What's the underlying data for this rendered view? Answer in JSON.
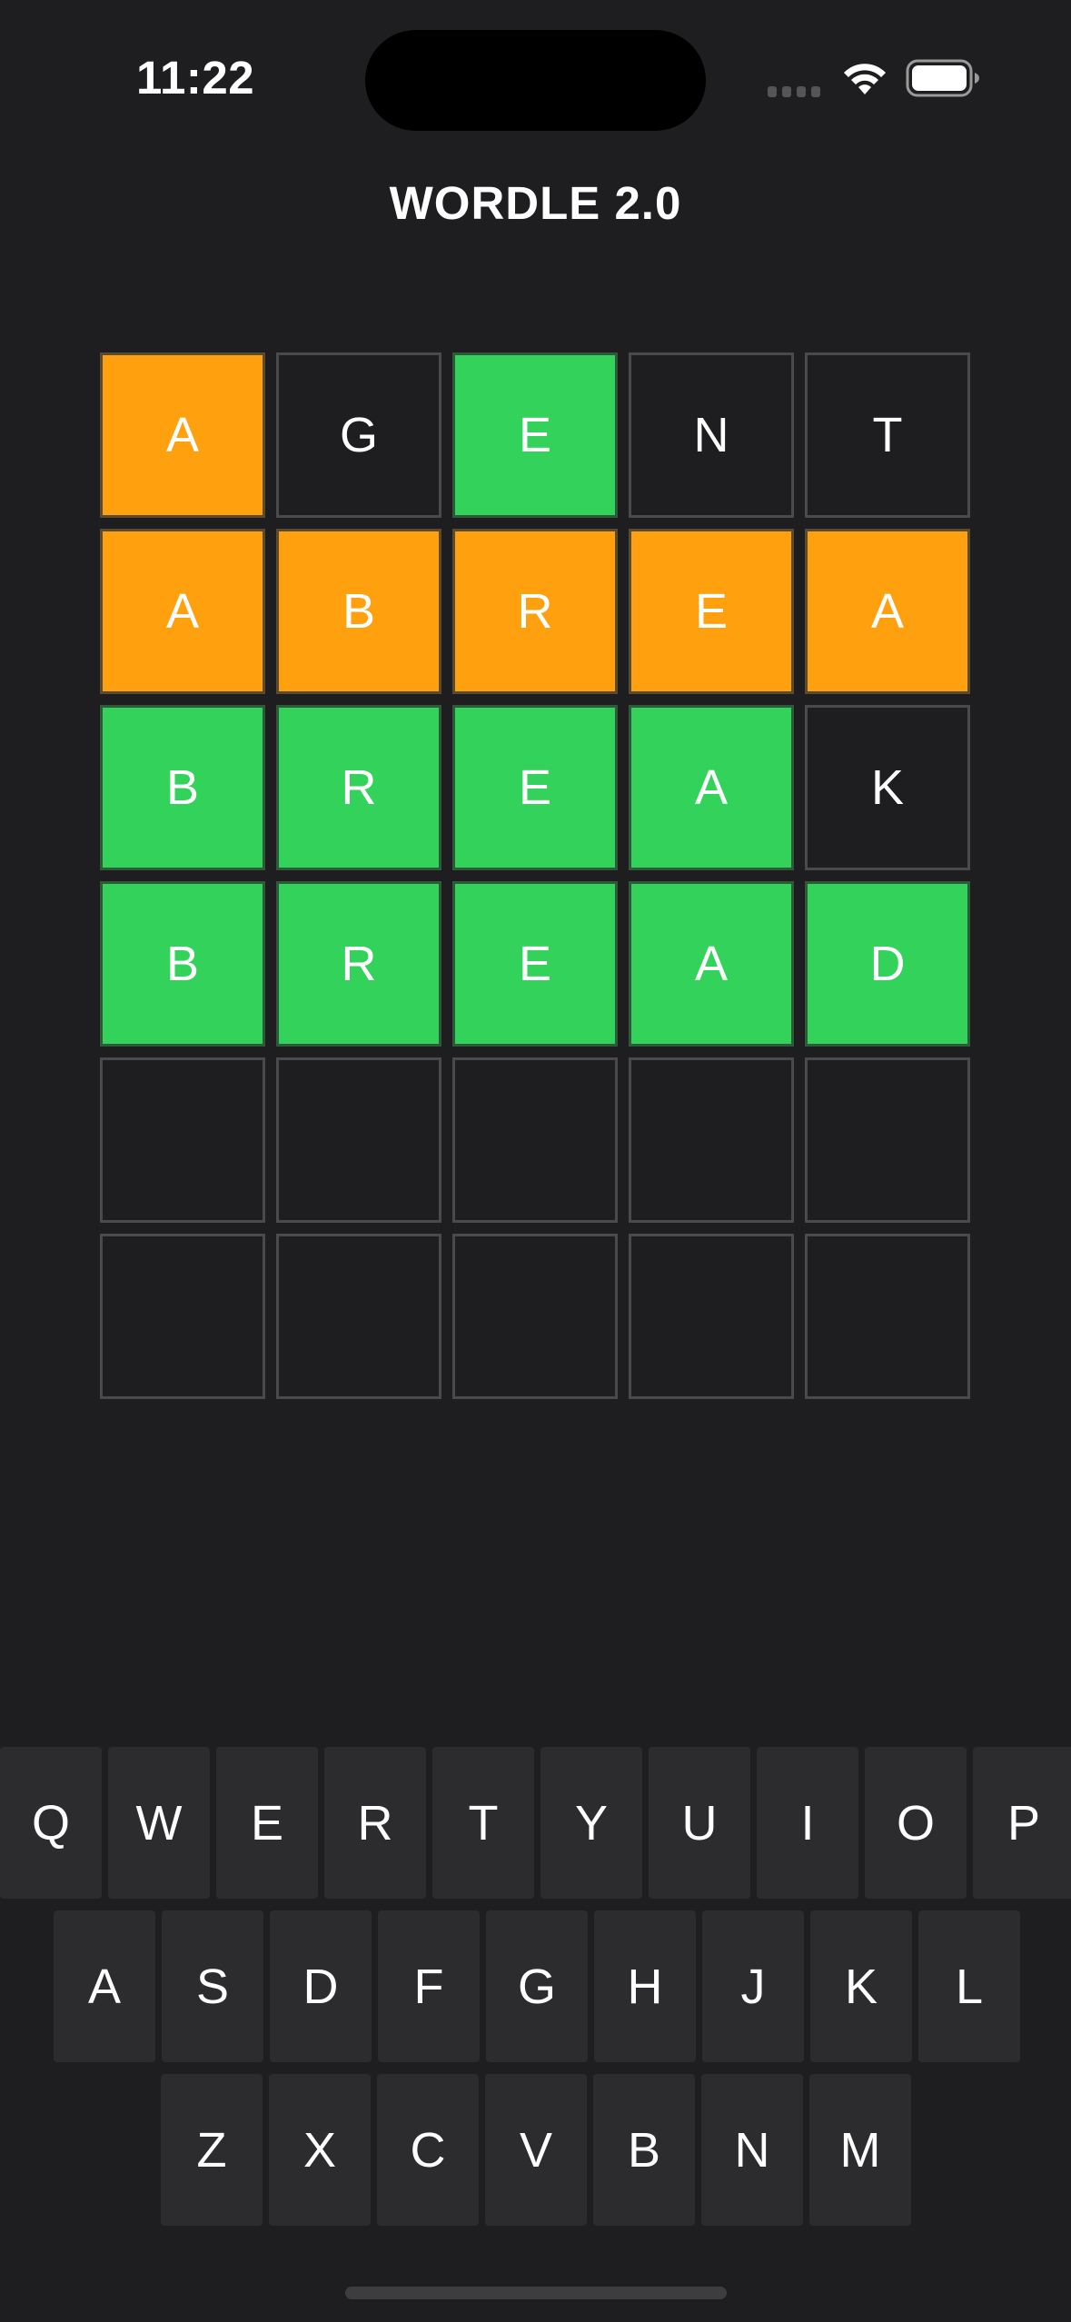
{
  "status_bar": {
    "time": "11:22"
  },
  "header": {
    "title": "WORDLE 2.0"
  },
  "colors": {
    "background": "#1e1e20",
    "present": "#ffa00f",
    "correct": "#33d35b",
    "empty_border": "#4a4a4c",
    "key": "#2c2c2e"
  },
  "board": {
    "rows": [
      [
        {
          "letter": "A",
          "state": "present"
        },
        {
          "letter": "G",
          "state": "absent"
        },
        {
          "letter": "E",
          "state": "correct"
        },
        {
          "letter": "N",
          "state": "absent"
        },
        {
          "letter": "T",
          "state": "absent"
        }
      ],
      [
        {
          "letter": "A",
          "state": "present"
        },
        {
          "letter": "B",
          "state": "present"
        },
        {
          "letter": "R",
          "state": "present"
        },
        {
          "letter": "E",
          "state": "present"
        },
        {
          "letter": "A",
          "state": "present"
        }
      ],
      [
        {
          "letter": "B",
          "state": "correct"
        },
        {
          "letter": "R",
          "state": "correct"
        },
        {
          "letter": "E",
          "state": "correct"
        },
        {
          "letter": "A",
          "state": "correct"
        },
        {
          "letter": "K",
          "state": "absent"
        }
      ],
      [
        {
          "letter": "B",
          "state": "correct"
        },
        {
          "letter": "R",
          "state": "correct"
        },
        {
          "letter": "E",
          "state": "correct"
        },
        {
          "letter": "A",
          "state": "correct"
        },
        {
          "letter": "D",
          "state": "correct"
        }
      ],
      [
        {
          "letter": "",
          "state": "empty"
        },
        {
          "letter": "",
          "state": "empty"
        },
        {
          "letter": "",
          "state": "empty"
        },
        {
          "letter": "",
          "state": "empty"
        },
        {
          "letter": "",
          "state": "empty"
        }
      ],
      [
        {
          "letter": "",
          "state": "empty"
        },
        {
          "letter": "",
          "state": "empty"
        },
        {
          "letter": "",
          "state": "empty"
        },
        {
          "letter": "",
          "state": "empty"
        },
        {
          "letter": "",
          "state": "empty"
        }
      ]
    ]
  },
  "keyboard": {
    "rows": [
      [
        "Q",
        "W",
        "E",
        "R",
        "T",
        "Y",
        "U",
        "I",
        "O",
        "P"
      ],
      [
        "A",
        "S",
        "D",
        "F",
        "G",
        "H",
        "J",
        "K",
        "L"
      ],
      [
        "Z",
        "X",
        "C",
        "V",
        "B",
        "N",
        "M"
      ]
    ]
  },
  "icons": {
    "wifi": "wifi-icon",
    "battery": "battery-icon",
    "signal": "cellular-signal-icon"
  }
}
